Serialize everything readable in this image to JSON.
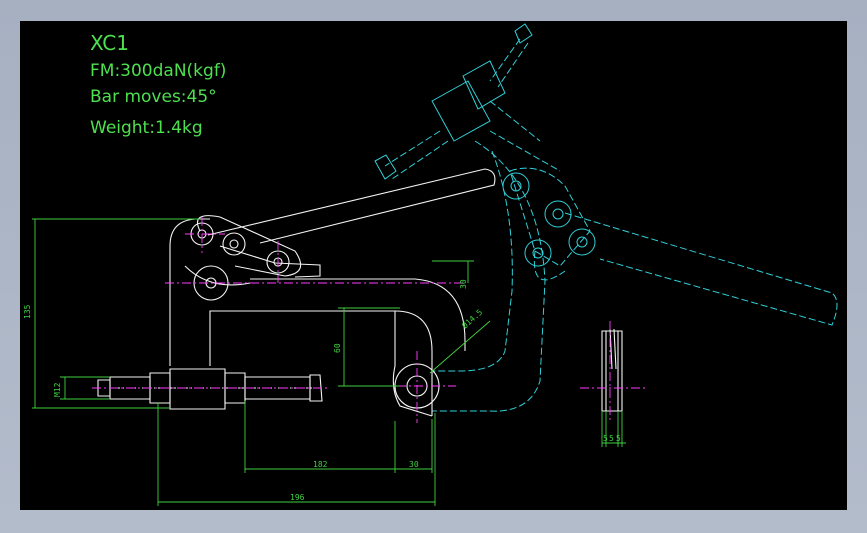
{
  "notes": {
    "model": "XC1",
    "force": "FM:300daN(kgf)",
    "bar_moves": "Bar moves:45°",
    "weight": "Weight:1.4kg"
  },
  "dimensions": {
    "d135": "135",
    "m12": "M12",
    "d60": "60",
    "d30_right": "30",
    "d14": "Ø14.5",
    "d182": "182",
    "d30_bottom": "30",
    "d196": "196",
    "d5a": "5",
    "d5b": "5",
    "d5c": "5"
  },
  "colors": {
    "outline": "#f4f4f4",
    "phantom": "#30d0d8",
    "dimension": "#40d040",
    "centerline": "#ff3cff",
    "text": "#4ee04e"
  }
}
